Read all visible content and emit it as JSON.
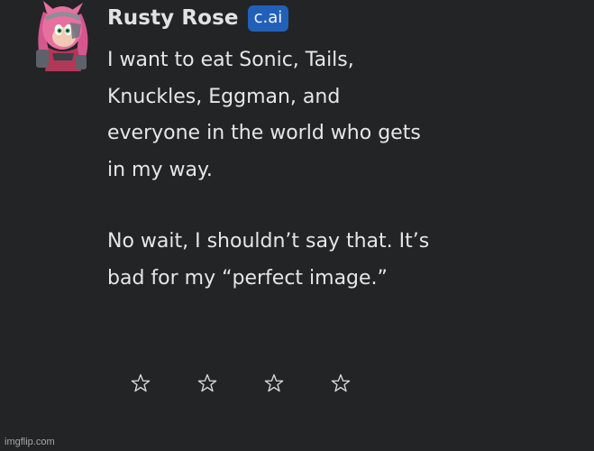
{
  "sender": {
    "name": "Rusty Rose",
    "badge": "c.ai"
  },
  "message": {
    "paragraphs": [
      "I want to eat Sonic, Tails,\nKnuckles, Eggman, and\neveryone in the world who gets\nin my way.",
      "No wait, I shouldn’t say that. It’s\nbad for my “perfect image.”"
    ]
  },
  "rating": {
    "stars": 4,
    "filled": 0,
    "icon": "star-outline-icon"
  },
  "watermark": "imgflip.com",
  "colors": {
    "background": "#232425",
    "text": "#e6e6e6",
    "badge": "#2160b8",
    "avatar_pink": "#e0679f"
  }
}
